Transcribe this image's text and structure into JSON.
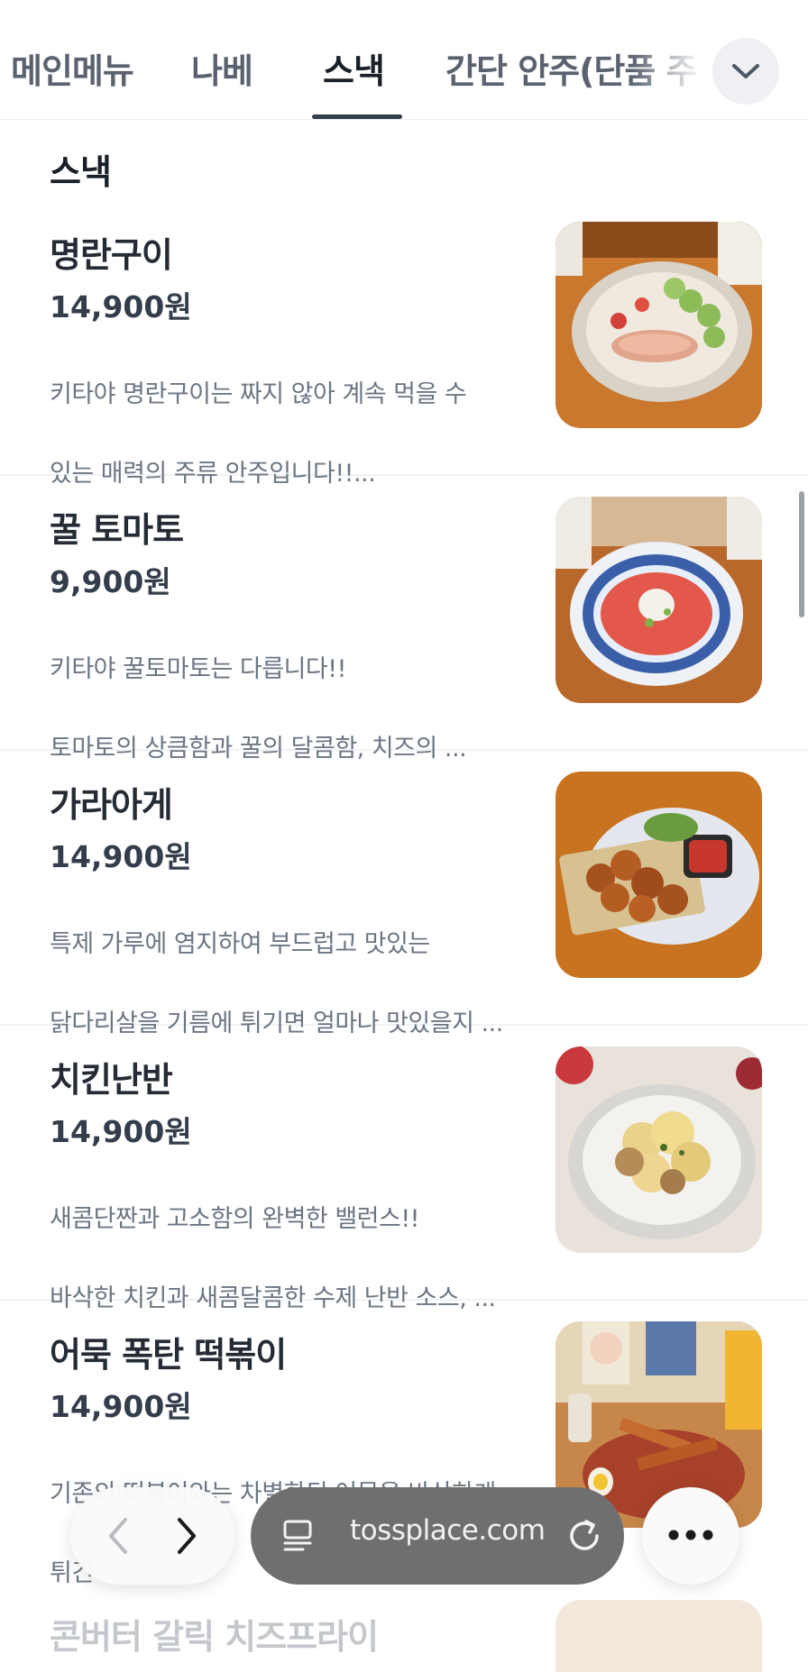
{
  "tabs": [
    {
      "label": "메인메뉴",
      "active": false
    },
    {
      "label": "나베",
      "active": false
    },
    {
      "label": "스낵",
      "active": true
    },
    {
      "label": "간단 안주(단품 주..",
      "active": false
    }
  ],
  "tab_more_icon": "chevron-down-icon",
  "section_title": "스낵",
  "items": [
    {
      "name": "명란구이",
      "price": "14,900원",
      "desc1": "키타야 명란구이는 짜지 않아 계속 먹을 수",
      "desc2": "있는 매력의 주류 안주입니다!!..."
    },
    {
      "name": "꿀 토마토",
      "price": "9,900원",
      "desc1": "키타야 꿀토마토는 다릅니다!!",
      "desc2": "토마토의 상큼함과 꿀의 달콤함, 치즈의 ..."
    },
    {
      "name": "가라아게",
      "price": "14,900원",
      "desc1": "특제 가루에 염지하여 부드럽고 맛있는",
      "desc2": "닭다리살을 기름에 튀기면 얼마나 맛있을지 ..."
    },
    {
      "name": "치킨난반",
      "price": "14,900원",
      "desc1": "새콤단짠과 고소함의 완벽한 밸런스!!",
      "desc2": "바삭한 치킨과 새콤달콤한 수제 난반 소스, ..."
    },
    {
      "name": "어묵 폭탄 떡볶이",
      "price": "14,900원",
      "desc1": "기존의 떡볶이와는 차별화된 어묵을 바삭하게",
      "desc2": "튀긴"
    }
  ],
  "peek_item_name": "콘버터 갈릭 치즈프라이",
  "browser": {
    "url": "tossplace.com",
    "back_icon": "chevron-left-icon",
    "forward_icon": "chevron-right-icon",
    "tabs_icon": "tab-overview-icon",
    "reload_icon": "reload-icon",
    "more_icon": "more-dots-icon"
  }
}
